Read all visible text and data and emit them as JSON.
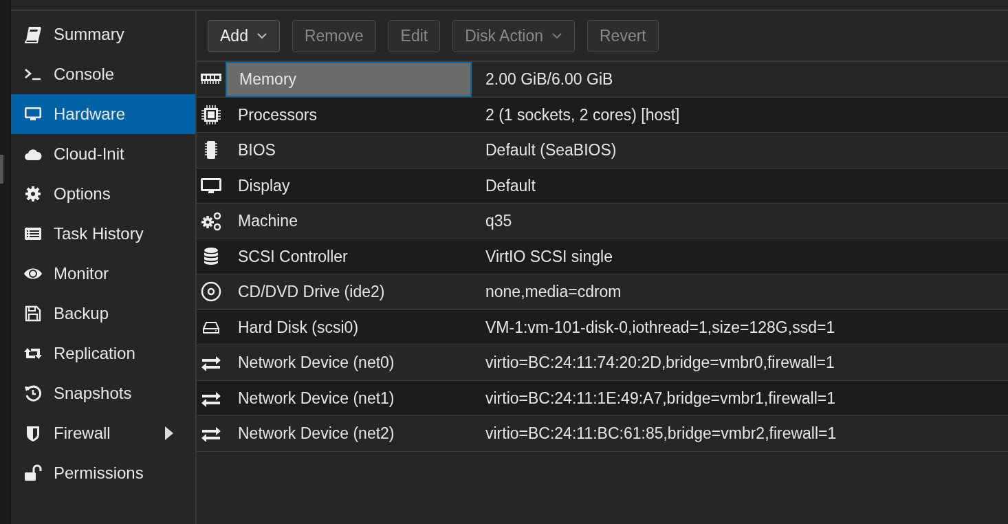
{
  "sidebar": {
    "items": [
      {
        "label": "Summary",
        "selected": false,
        "submenu": false
      },
      {
        "label": "Console",
        "selected": false,
        "submenu": false
      },
      {
        "label": "Hardware",
        "selected": true,
        "submenu": false
      },
      {
        "label": "Cloud-Init",
        "selected": false,
        "submenu": false
      },
      {
        "label": "Options",
        "selected": false,
        "submenu": false
      },
      {
        "label": "Task History",
        "selected": false,
        "submenu": false
      },
      {
        "label": "Monitor",
        "selected": false,
        "submenu": false
      },
      {
        "label": "Backup",
        "selected": false,
        "submenu": false
      },
      {
        "label": "Replication",
        "selected": false,
        "submenu": false
      },
      {
        "label": "Snapshots",
        "selected": false,
        "submenu": false
      },
      {
        "label": "Firewall",
        "selected": false,
        "submenu": true
      },
      {
        "label": "Permissions",
        "selected": false,
        "submenu": false
      }
    ]
  },
  "toolbar": {
    "buttons": [
      {
        "label": "Add",
        "disabled": false,
        "dropdown": true
      },
      {
        "label": "Remove",
        "disabled": true,
        "dropdown": false
      },
      {
        "label": "Edit",
        "disabled": true,
        "dropdown": false
      },
      {
        "label": "Disk Action",
        "disabled": true,
        "dropdown": true
      },
      {
        "label": "Revert",
        "disabled": true,
        "dropdown": false
      }
    ]
  },
  "table": {
    "rows": [
      {
        "name": "Memory",
        "value": "2.00 GiB/6.00 GiB",
        "selected": true
      },
      {
        "name": "Processors",
        "value": "2 (1 sockets, 2 cores) [host]",
        "selected": false
      },
      {
        "name": "BIOS",
        "value": "Default (SeaBIOS)",
        "selected": false
      },
      {
        "name": "Display",
        "value": "Default",
        "selected": false
      },
      {
        "name": "Machine",
        "value": "q35",
        "selected": false
      },
      {
        "name": "SCSI Controller",
        "value": "VirtIO SCSI single",
        "selected": false
      },
      {
        "name": "CD/DVD Drive (ide2)",
        "value": "none,media=cdrom",
        "selected": false
      },
      {
        "name": "Hard Disk (scsi0)",
        "value": "VM-1:vm-101-disk-0,iothread=1,size=128G,ssd=1",
        "selected": false
      },
      {
        "name": "Network Device (net0)",
        "value": "virtio=BC:24:11:74:20:2D,bridge=vmbr0,firewall=1",
        "selected": false
      },
      {
        "name": "Network Device (net1)",
        "value": "virtio=BC:24:11:1E:49:A7,bridge=vmbr1,firewall=1",
        "selected": false
      },
      {
        "name": "Network Device (net2)",
        "value": "virtio=BC:24:11:BC:61:85,bridge=vmbr2,firewall=1",
        "selected": false
      }
    ]
  }
}
